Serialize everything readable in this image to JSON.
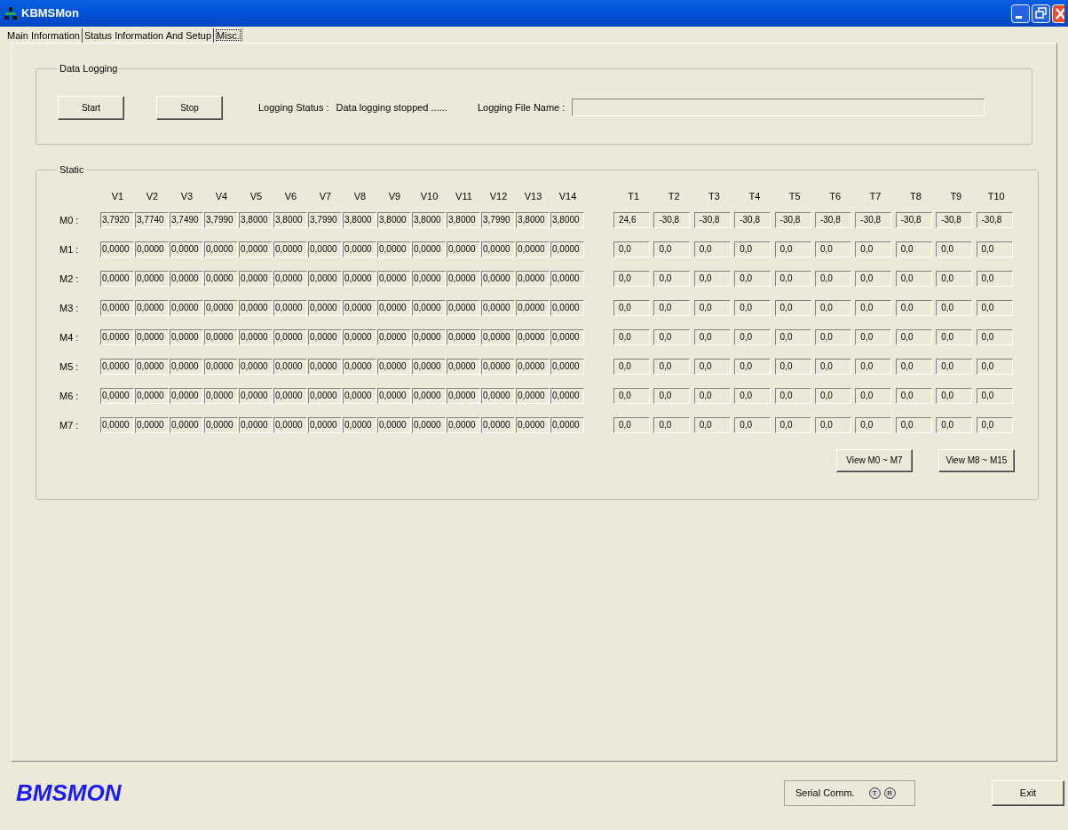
{
  "window": {
    "title": "KBMSMon"
  },
  "tabs": [
    {
      "label": "Main Information",
      "selected": false
    },
    {
      "label": "Status Information And Setup",
      "selected": false
    },
    {
      "label": "Misc.",
      "selected": true
    }
  ],
  "data_logging": {
    "title": "Data Logging",
    "buttons": [
      "Start",
      "Stop"
    ],
    "status_label": "Logging Status :",
    "status_value": "Data logging stopped ......",
    "file_label": "Logging File Name :"
  },
  "static": {
    "title": "Static",
    "v_columns": [
      "V1",
      "V2",
      "V3",
      "V4",
      "V5",
      "V6",
      "V7",
      "V8",
      "V9",
      "V10",
      "V11",
      "V12",
      "V13",
      "V14"
    ],
    "t_columns": [
      "T1",
      "T2",
      "T3",
      "T4",
      "T5",
      "T6",
      "T7",
      "T8",
      "T9",
      "T10"
    ],
    "rows": [
      {
        "label": "M0 :",
        "v": [
          "3,7920",
          "3,7740",
          "3,7490",
          "3,7990",
          "3,8000",
          "3,8000",
          "3,7990",
          "3,8000",
          "3,8000",
          "3,8000",
          "3,8000",
          "3,7990",
          "3,8000",
          "3,8000"
        ],
        "t": [
          "24,6",
          "-30,8",
          "-30,8",
          "-30,8",
          "-30,8",
          "-30,8",
          "-30,8",
          "-30,8",
          "-30,8",
          "-30,8"
        ]
      },
      {
        "label": "M1 :",
        "v": [
          "0,0000",
          "0,0000",
          "0,0000",
          "0,0000",
          "0,0000",
          "0,0000",
          "0,0000",
          "0,0000",
          "0,0000",
          "0,0000",
          "0,0000",
          "0,0000",
          "0,0000",
          "0,0000"
        ],
        "t": [
          "0,0",
          "0,0",
          "0,0",
          "0,0",
          "0,0",
          "0,0",
          "0,0",
          "0,0",
          "0,0",
          "0,0"
        ]
      },
      {
        "label": "M2 :",
        "v": [
          "0,0000",
          "0,0000",
          "0,0000",
          "0,0000",
          "0,0000",
          "0,0000",
          "0,0000",
          "0,0000",
          "0,0000",
          "0,0000",
          "0,0000",
          "0,0000",
          "0,0000",
          "0,0000"
        ],
        "t": [
          "0,0",
          "0,0",
          "0,0",
          "0,0",
          "0,0",
          "0,0",
          "0,0",
          "0,0",
          "0,0",
          "0,0"
        ]
      },
      {
        "label": "M3 :",
        "v": [
          "0,0000",
          "0,0000",
          "0,0000",
          "0,0000",
          "0,0000",
          "0,0000",
          "0,0000",
          "0,0000",
          "0,0000",
          "0,0000",
          "0,0000",
          "0,0000",
          "0,0000",
          "0,0000"
        ],
        "t": [
          "0,0",
          "0,0",
          "0,0",
          "0,0",
          "0,0",
          "0,0",
          "0,0",
          "0,0",
          "0,0",
          "0,0"
        ]
      },
      {
        "label": "M4 :",
        "v": [
          "0,0000",
          "0,0000",
          "0,0000",
          "0,0000",
          "0,0000",
          "0,0000",
          "0,0000",
          "0,0000",
          "0,0000",
          "0,0000",
          "0,0000",
          "0,0000",
          "0,0000",
          "0,0000"
        ],
        "t": [
          "0,0",
          "0,0",
          "0,0",
          "0,0",
          "0,0",
          "0,0",
          "0,0",
          "0,0",
          "0,0",
          "0,0"
        ]
      },
      {
        "label": "M5 :",
        "v": [
          "0,0000",
          "0,0000",
          "0,0000",
          "0,0000",
          "0,0000",
          "0,0000",
          "0,0000",
          "0,0000",
          "0,0000",
          "0,0000",
          "0,0000",
          "0,0000",
          "0,0000",
          "0,0000"
        ],
        "t": [
          "0,0",
          "0,0",
          "0,0",
          "0,0",
          "0,0",
          "0,0",
          "0,0",
          "0,0",
          "0,0",
          "0,0"
        ]
      },
      {
        "label": "M6 :",
        "v": [
          "0,0000",
          "0,0000",
          "0,0000",
          "0,0000",
          "0,0000",
          "0,0000",
          "0,0000",
          "0,0000",
          "0,0000",
          "0,0000",
          "0,0000",
          "0,0000",
          "0,0000",
          "0,0000"
        ],
        "t": [
          "0,0",
          "0,0",
          "0,0",
          "0,0",
          "0,0",
          "0,0",
          "0,0",
          "0,0",
          "0,0",
          "0,0"
        ]
      },
      {
        "label": "M7 :",
        "v": [
          "0,0000",
          "0,0000",
          "0,0000",
          "0,0000",
          "0,0000",
          "0,0000",
          "0,0000",
          "0,0000",
          "0,0000",
          "0,0000",
          "0,0000",
          "0,0000",
          "0,0000",
          "0,0000"
        ],
        "t": [
          "0,0",
          "0,0",
          "0,0",
          "0,0",
          "0,0",
          "0,0",
          "0,0",
          "0,0",
          "0,0",
          "0,0"
        ]
      }
    ],
    "buttons": [
      "View M0 ~ M7",
      "View M8 ~ M15"
    ]
  },
  "footer": {
    "logo": "BMSMON",
    "serial_label": "Serial Comm.",
    "indicators": [
      "T",
      "R"
    ],
    "exit": "Exit"
  }
}
